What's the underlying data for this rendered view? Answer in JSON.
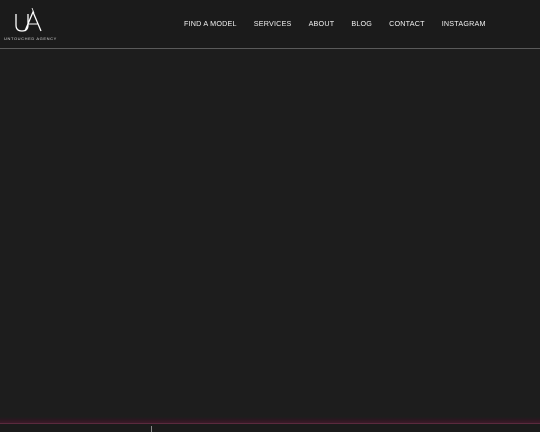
{
  "brand": {
    "logo_letters": "UA",
    "caption": "UNTOUCHED AGENCY"
  },
  "nav": {
    "items": [
      {
        "label": "FIND A MODEL"
      },
      {
        "label": "SERVICES"
      },
      {
        "label": "ABOUT"
      },
      {
        "label": "BLOG"
      },
      {
        "label": "CONTACT"
      },
      {
        "label": "INSTAGRAM"
      }
    ]
  },
  "colors": {
    "background": "#1d1d1d",
    "header": "#1b1b1b",
    "text": "#ffffff",
    "accent": "#5a2a3e"
  }
}
